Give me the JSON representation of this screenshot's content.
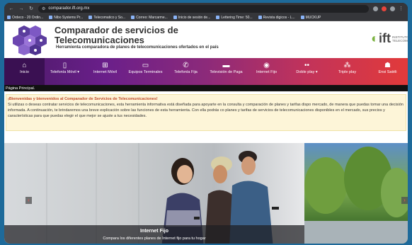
{
  "browser": {
    "url": "comparador.ift.org.mx",
    "bookmarks": [
      "Ordeco - 20 Ordin...",
      "Nibo Systems Pr...",
      "Telecomatico y So...",
      "Correo: Marcarme...",
      "Inicio de sesión de...",
      "Lettering Time: 50...",
      "Revista digicos - L...",
      "MUCKUP"
    ]
  },
  "header": {
    "title_line1": "Comparador de servicios de",
    "title_line2": "Telecomunicaciones",
    "subtitle": "Herramienta comparadora de planes de telecomunicaciones ofertados en el país",
    "ift_logo": "ift",
    "ift_institute": "INSTITUTO TELECOMU"
  },
  "menu": [
    {
      "icon": "home-icon",
      "glyph": "⌂",
      "label": "Inicio"
    },
    {
      "icon": "mobile-phone-icon",
      "glyph": "▯",
      "label": "Telefonía Móvil ▾"
    },
    {
      "icon": "mobile-internet-icon",
      "glyph": "⊞",
      "label": "Internet Móvil"
    },
    {
      "icon": "devices-icon",
      "glyph": "▭",
      "label": "Equipos Terminales"
    },
    {
      "icon": "landline-phone-icon",
      "glyph": "✆",
      "label": "Telefonía Fija"
    },
    {
      "icon": "pay-tv-icon",
      "glyph": "▬",
      "label": "Televisión de Paga"
    },
    {
      "icon": "fixed-internet-icon",
      "glyph": "◉",
      "label": "Internet Fijo"
    },
    {
      "icon": "double-play-icon",
      "glyph": "••",
      "label": "Doble play ▾"
    },
    {
      "icon": "triple-play-icon",
      "glyph": "⁂",
      "label": "Triple play"
    },
    {
      "icon": "satellite-icon",
      "glyph": "☗",
      "label": "Ensi Satéli"
    }
  ],
  "breadcrumb": "Página Principal.",
  "welcome": {
    "heading": "¡Bienvenidas y bienvenidos al Comparador de Servicios de Telecomunicaciones!",
    "body": "Si utilizas o deseas contratar servicios de telecomunicaciones, esta herramienta informativa está diseñada para apoyarte en la consulta y comparación de planes y tarifas dispo mercado, de manera que puedas tomar una decisión informada. A continuación, te brindaremos una breve explicación sobre las funciones de esta herramienta. Con ella podrás co planes y tarifas de servicios de telecomunicaciones disponibles en el mercado, sus precios y características para que puedas elegir el que mejor se ajuste a tus necesidades."
  },
  "carousel": {
    "caption_title": "Internet Fijo",
    "caption_sub": "Compara los diferentes planes de Internet fijo para tu hogar",
    "prev": "‹",
    "next": "›"
  },
  "colors": {
    "menu_start": "#4a1a66",
    "menu_end": "#e23a3a",
    "welcome_bg": "#fdf5d8"
  }
}
